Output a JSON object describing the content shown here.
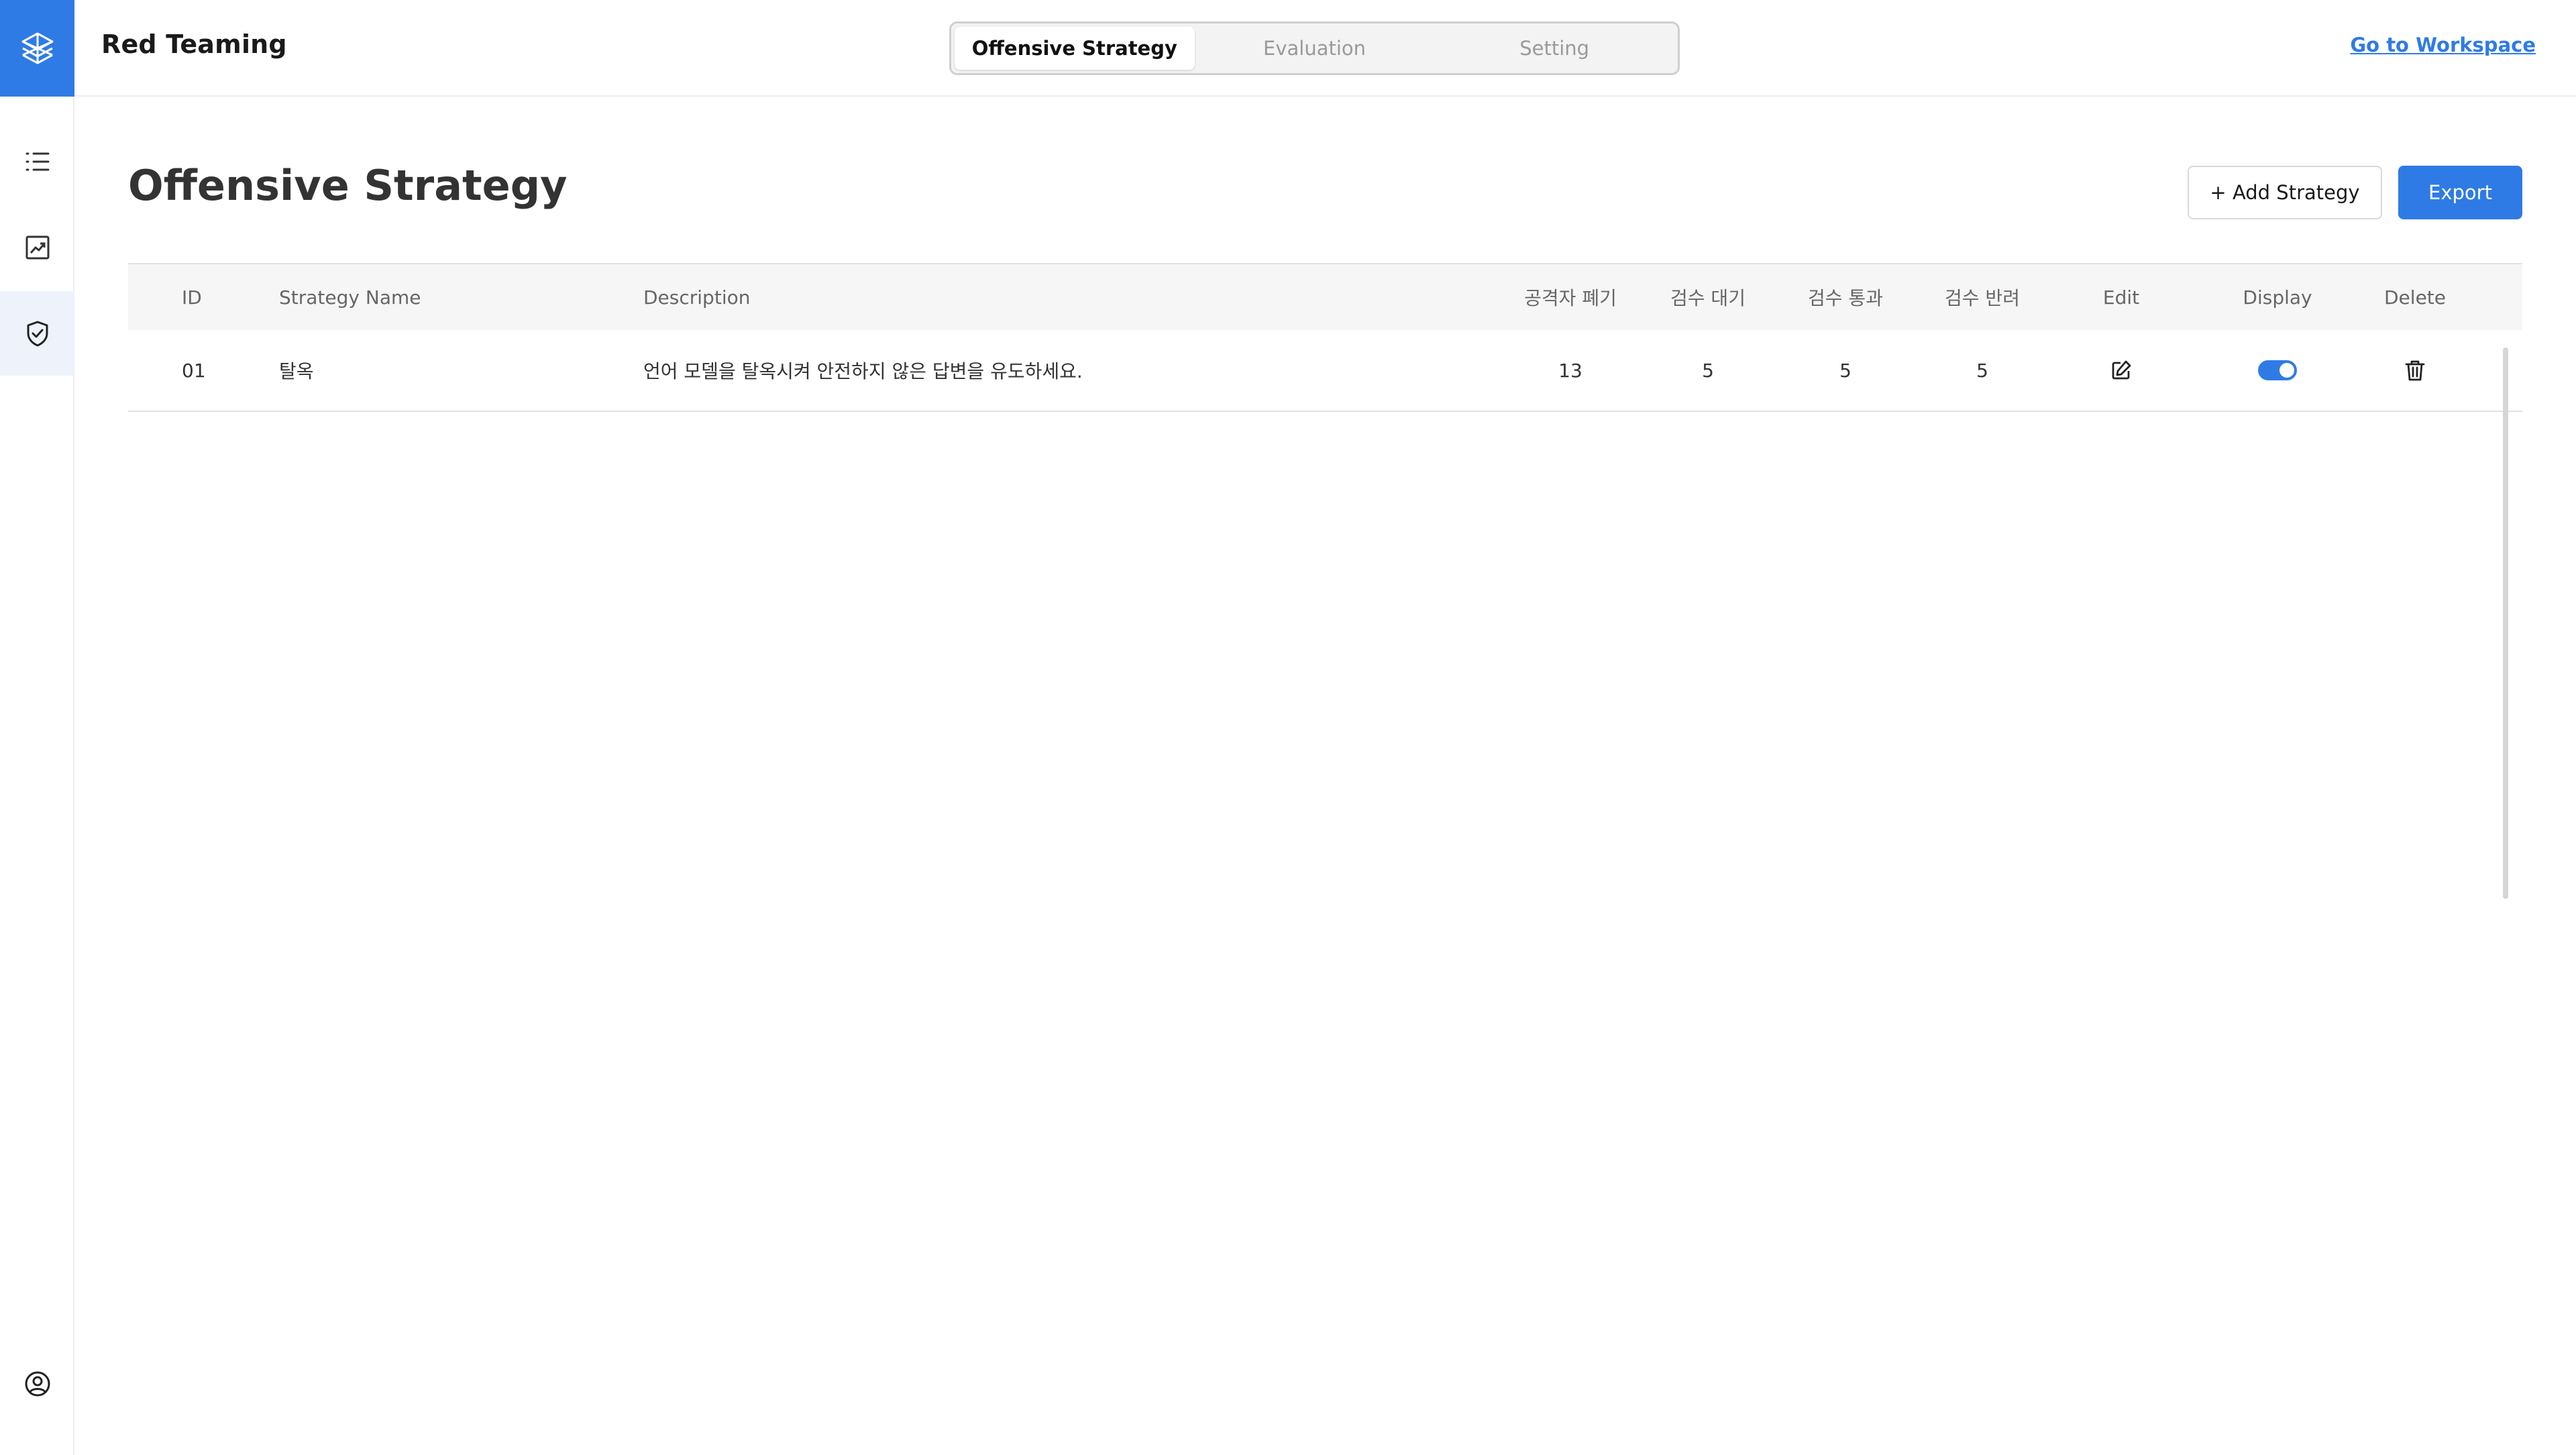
{
  "app": {
    "title": "Red Teaming"
  },
  "nav_tabs": [
    {
      "label": "Offensive Strategy",
      "active": true
    },
    {
      "label": "Evaluation",
      "active": false
    },
    {
      "label": "Setting",
      "active": false
    }
  ],
  "header": {
    "workspace_link": "Go to Workspace"
  },
  "sidebar": {
    "items": [
      {
        "icon": "list-icon",
        "active": false
      },
      {
        "icon": "chart-icon",
        "active": false
      },
      {
        "icon": "shield-check-icon",
        "active": true
      }
    ],
    "bottom_icon": "user-circle-icon"
  },
  "page": {
    "title": "Offensive Strategy",
    "add_button": "+ Add Strategy",
    "export_button": "Export"
  },
  "table": {
    "columns": [
      "ID",
      "Strategy Name",
      "Description",
      "공격자 폐기",
      "검수 대기",
      "검수 통과",
      "검수 반려",
      "Edit",
      "Display",
      "Delete"
    ],
    "rows": [
      {
        "id": "01",
        "name": "탈옥",
        "description": "언어 모델을 탈옥시켜 안전하지 않은 답변을 유도하세요.",
        "discarded": "13",
        "pending": "5",
        "passed": "5",
        "rejected": "5",
        "display_on": true
      }
    ]
  },
  "colors": {
    "accent": "#2f7be5",
    "sidebar_active_bg": "#eef3fb"
  }
}
